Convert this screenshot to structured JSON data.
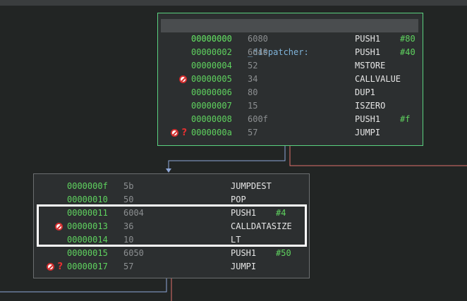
{
  "colors": {
    "background": "#222524",
    "node_bg": "#2c2f30",
    "selected_border": "#5ad17f",
    "address": "#5fd35f",
    "edge_blue": "#8fa8d9",
    "edge_red": "#e0716b"
  },
  "block_a": {
    "label_addr": "00000000",
    "label_name": "_dispatcher:",
    "rows": [
      {
        "addr": "00000000",
        "hex": "6080",
        "mnem": "PUSH1",
        "arg": "#80",
        "icons": []
      },
      {
        "addr": "00000002",
        "hex": "6040",
        "mnem": "PUSH1",
        "arg": "#40",
        "icons": []
      },
      {
        "addr": "00000004",
        "hex": "52",
        "mnem": "MSTORE",
        "arg": "",
        "icons": []
      },
      {
        "addr": "00000005",
        "hex": "34",
        "mnem": "CALLVALUE",
        "arg": "",
        "icons": [
          "stop-icon"
        ]
      },
      {
        "addr": "00000006",
        "hex": "80",
        "mnem": "DUP1",
        "arg": "",
        "icons": []
      },
      {
        "addr": "00000007",
        "hex": "15",
        "mnem": "ISZERO",
        "arg": "",
        "icons": []
      },
      {
        "addr": "00000008",
        "hex": "600f",
        "mnem": "PUSH1",
        "arg": "#f",
        "icons": []
      },
      {
        "addr": "0000000a",
        "hex": "57",
        "mnem": "JUMPI",
        "arg": "",
        "icons": [
          "stop-icon",
          "question-icon"
        ]
      }
    ]
  },
  "block_b": {
    "rows": [
      {
        "addr": "0000000f",
        "hex": "5b",
        "mnem": "JUMPDEST",
        "arg": "",
        "icons": []
      },
      {
        "addr": "00000010",
        "hex": "50",
        "mnem": "POP",
        "arg": "",
        "icons": []
      },
      {
        "addr": "00000011",
        "hex": "6004",
        "mnem": "PUSH1",
        "arg": "#4",
        "icons": []
      },
      {
        "addr": "00000013",
        "hex": "36",
        "mnem": "CALLDATASIZE",
        "arg": "",
        "icons": [
          "stop-icon"
        ]
      },
      {
        "addr": "00000014",
        "hex": "10",
        "mnem": "LT",
        "arg": "",
        "icons": []
      },
      {
        "addr": "00000015",
        "hex": "6050",
        "mnem": "PUSH1",
        "arg": "#50",
        "icons": []
      },
      {
        "addr": "00000017",
        "hex": "57",
        "mnem": "JUMPI",
        "arg": "",
        "icons": [
          "stop-icon",
          "question-icon"
        ]
      }
    ]
  }
}
